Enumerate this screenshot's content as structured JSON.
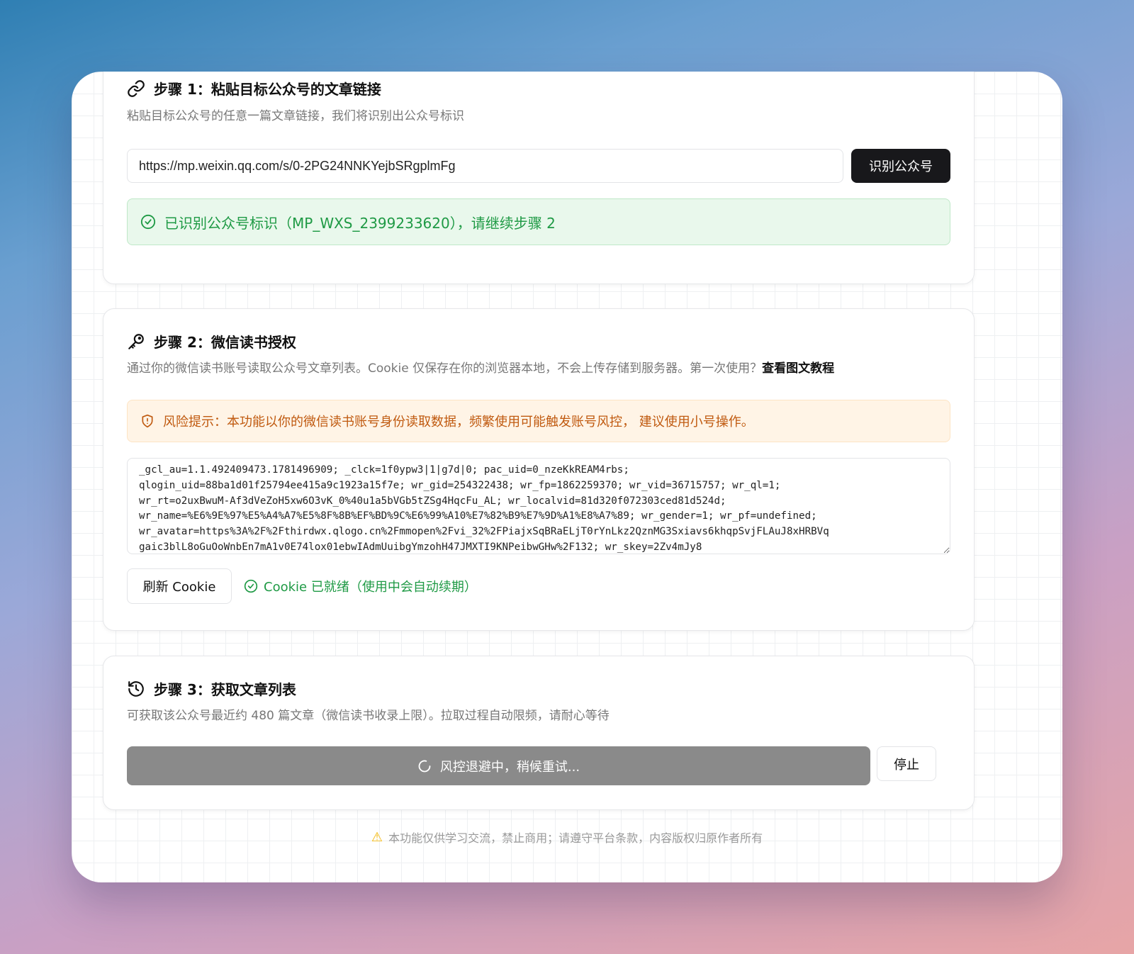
{
  "step1": {
    "icon": "link-icon",
    "title": "步骤 1：粘贴目标公众号的文章链接",
    "desc": "粘贴目标公众号的任意一篇文章链接，我们将识别出公众号标识",
    "url_value": "https://mp.weixin.qq.com/s/0-2PG24NNKYejbSRgplmFg",
    "identify_button": "识别公众号",
    "success_message": "已识别公众号标识（MP_WXS_2399233620），请继续步骤 2"
  },
  "step2": {
    "icon": "key-icon",
    "title": "步骤 2：微信读书授权",
    "desc": "通过你的微信读书账号读取公众号文章列表。Cookie 仅保存在你的浏览器本地，不会上传存储到服务器。第一次使用？",
    "tutorial_link": "查看图文教程",
    "warning": "风险提示：本功能以你的微信读书账号身份读取数据，频繁使用可能触发账号风控，  建议使用小号操作。",
    "cookie_value": "_gcl_au=1.1.492409473.1781496909; _clck=1f0ypw3|1|g7d|0; pac_uid=0_nzeKkREAM4rbs;\nqlogin_uid=88ba1d01f25794ee415a9c1923a15f7e; wr_gid=254322438; wr_fp=1862259370; wr_vid=36715757; wr_ql=1;\nwr_rt=o2uxBwuM-Af3dVeZoH5xw6O3vK_0%40u1a5bVGb5tZSg4HqcFu_AL; wr_localvid=81d320f072303ced81d524d;\nwr_name=%E6%9E%97%E5%A4%A7%E5%8F%8B%EF%BD%9C%E6%99%A10%E7%82%B9%E7%9D%A1%E8%A7%89; wr_gender=1; wr_pf=undefined;\nwr_avatar=https%3A%2F%2Fthirdwx.qlogo.cn%2Fmmopen%2Fvi_32%2FPiajxSqBRaELjT0rYnLkz2QznMG3Sxiavs6khqpSvjFLAuJ8xHRBVq\ngaic3blL8oGuOoWnbEn7mA1v0E74lox01ebwIAdmUuibgYmzohH47JMXTI9KNPeibwGHw%2F132; wr_skey=2Zv4mJy8",
    "refresh_button": "刷新 Cookie",
    "cookie_status": "Cookie 已就绪（使用中会自动续期）"
  },
  "step3": {
    "icon": "history-icon",
    "title": "步骤 3：获取文章列表",
    "desc": "可获取该公众号最近约 480 篇文章（微信读书收录上限）。拉取过程自动限频，请耐心等待",
    "progress_button": "风控退避中，稍候重试...",
    "stop_button": "停止"
  },
  "footer": {
    "icon": "warning-icon",
    "text": "本功能仅供学习交流，禁止商用；请遵守平台条款，内容版权归原作者所有"
  },
  "colors": {
    "success": "#1f9a45",
    "warning": "#c05a10",
    "dark_button": "#18181b",
    "progress_button": "#8a8a8a"
  }
}
